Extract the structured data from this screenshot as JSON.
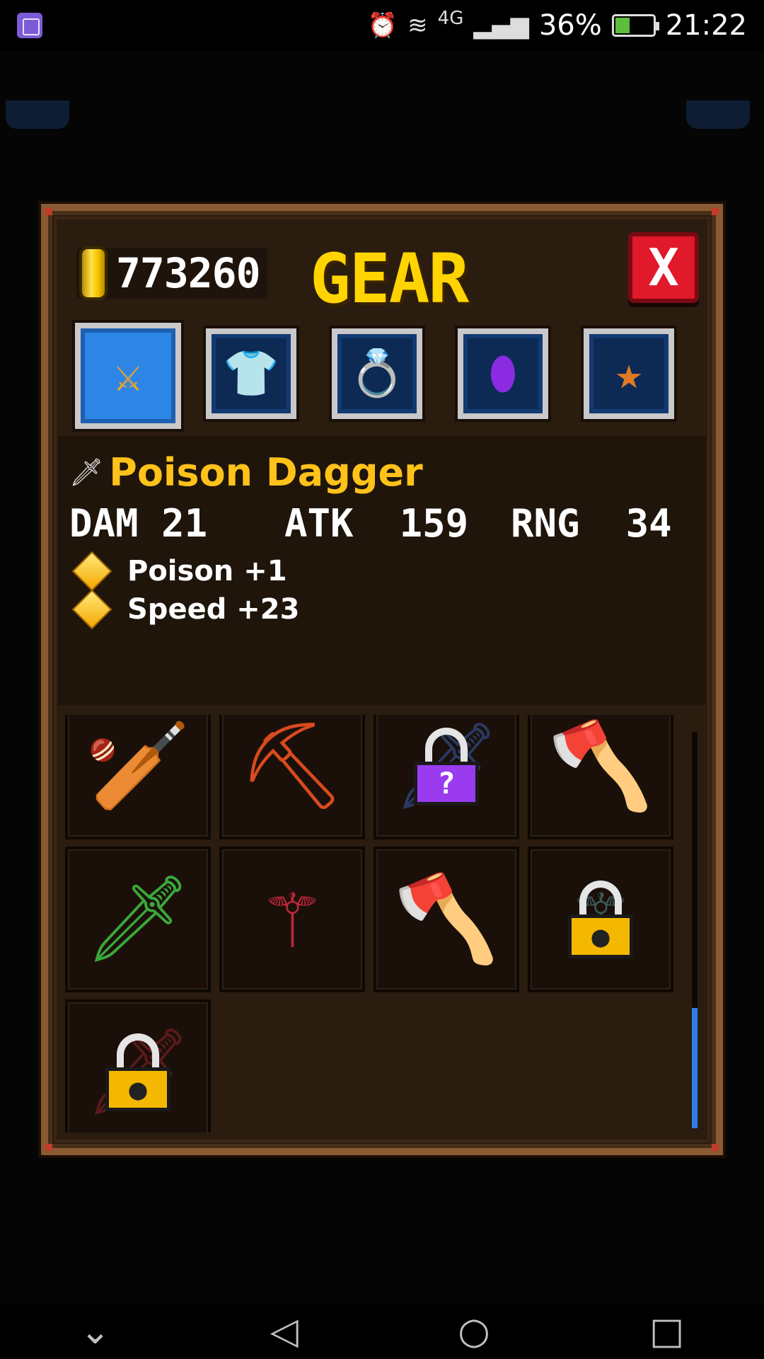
{
  "status_bar": {
    "network": "4G",
    "battery_percent": "36%",
    "time": "21:22"
  },
  "panel": {
    "gold_amount": "773260",
    "title": "GEAR",
    "close_label": "X"
  },
  "tabs": [
    {
      "name": "weapons",
      "icon": "sword-icon",
      "active": true
    },
    {
      "name": "armor",
      "icon": "shirt-icon",
      "active": false
    },
    {
      "name": "rings",
      "icon": "ring-icon",
      "active": false
    },
    {
      "name": "gems",
      "icon": "gem-icon",
      "active": false
    },
    {
      "name": "badges",
      "icon": "star-icon",
      "active": false
    }
  ],
  "item": {
    "name": "Poison Dagger",
    "stats": {
      "dam_label": "DAM",
      "dam_value": "21",
      "atk_label": "ATK",
      "atk_value": "159",
      "rng_label": "RNG",
      "rng_value": "34"
    },
    "perks": [
      "Poison +1",
      "Speed +23"
    ]
  },
  "inventory": [
    {
      "icon": "ice-club-icon",
      "locked": false
    },
    {
      "icon": "lava-scythe-icon",
      "locked": false
    },
    {
      "icon": "mystery-weapon-icon",
      "locked": true,
      "lock_type": "purple",
      "lock_label": "?"
    },
    {
      "icon": "bat-axe-icon",
      "locked": false
    },
    {
      "icon": "thorn-blade-icon",
      "locked": false
    },
    {
      "icon": "blood-staff-icon",
      "locked": false
    },
    {
      "icon": "double-axe-icon",
      "locked": false
    },
    {
      "icon": "wraith-staff-icon",
      "locked": true,
      "lock_type": "gold"
    },
    {
      "icon": "dark-blade-icon",
      "locked": true,
      "lock_type": "gold"
    }
  ],
  "colors": {
    "title_gold": "#ffd400",
    "item_name": "#ffc21a",
    "close_red": "#e0192b",
    "active_tab": "#2d86e5",
    "scroll_thumb": "#2e7de8"
  },
  "scroll_position": 1.0
}
